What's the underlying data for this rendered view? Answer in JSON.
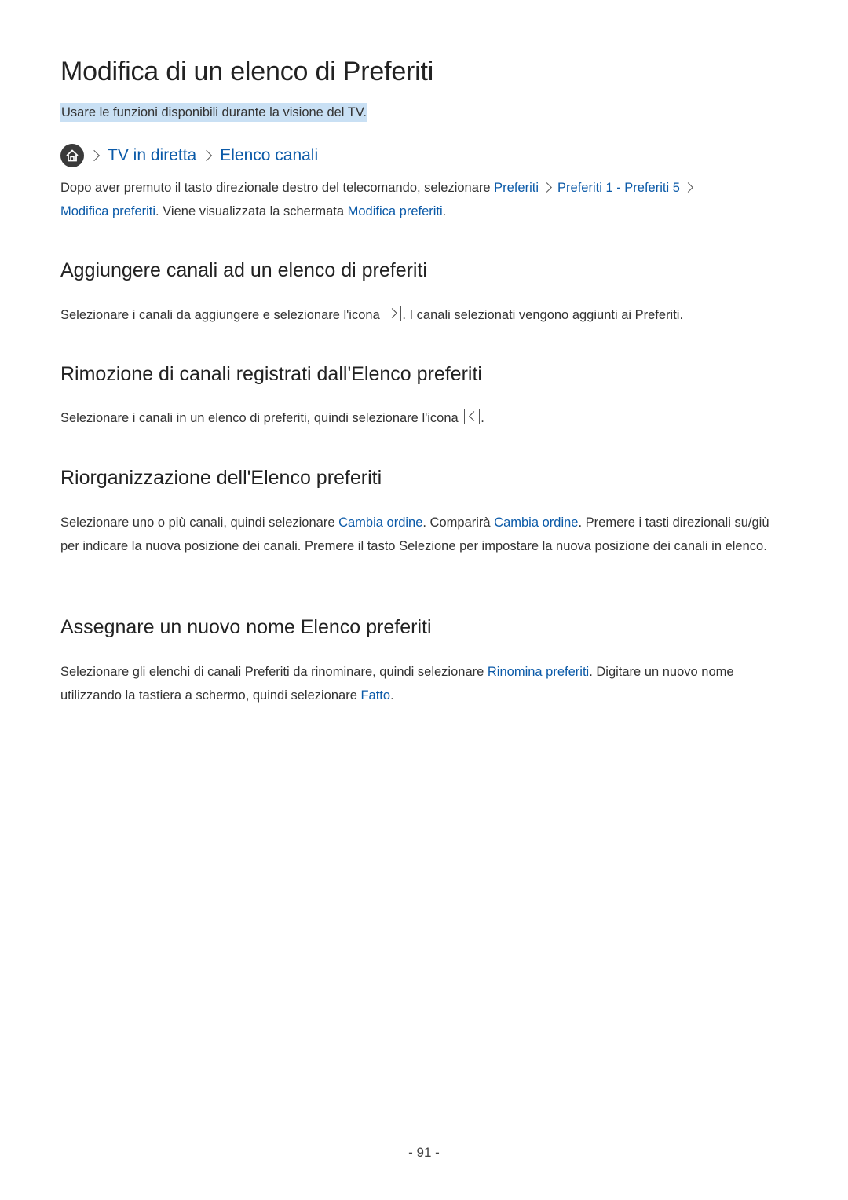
{
  "title": "Modifica di un elenco di Preferiti",
  "subtitle": "Usare le funzioni disponibili durante la visione del TV.",
  "breadcrumb": {
    "home_icon": "home-icon",
    "items": [
      "TV in diretta",
      "Elenco canali"
    ]
  },
  "intro": {
    "t1": "Dopo aver premuto il tasto direzionale destro del telecomando, selezionare ",
    "l1": "Preferiti",
    "l2": "Preferiti 1 - Preferiti 5",
    "l3": "Modifica preferiti",
    "t2": ". Viene visualizzata la schermata ",
    "l4": "Modifica preferiti",
    "t3": "."
  },
  "sections": [
    {
      "heading": "Aggiungere canali ad un elenco di preferiti",
      "t1": "Selezionare i canali da aggiungere e selezionare l'icona ",
      "icon": "chevron-right-box-icon",
      "t2": ". I canali selezionati vengono aggiunti ai Preferiti."
    },
    {
      "heading": "Rimozione di canali registrati dall'Elenco preferiti",
      "t1": "Selezionare i canali in un elenco di preferiti, quindi selezionare l'icona ",
      "icon": "chevron-left-box-icon",
      "t2": "."
    },
    {
      "heading": "Riorganizzazione dell'Elenco preferiti",
      "t1": "Selezionare uno o più canali, quindi selezionare ",
      "l1": "Cambia ordine",
      "t2": ". Comparirà ",
      "l2": "Cambia ordine",
      "t3": ". Premere i tasti direzionali su/giù per indicare la nuova posizione dei canali. Premere il tasto Selezione per impostare la nuova posizione dei canali in elenco."
    },
    {
      "heading": "Assegnare un nuovo nome Elenco preferiti",
      "t1": "Selezionare gli elenchi di canali Preferiti da rinominare, quindi selezionare ",
      "l1": "Rinomina preferiti",
      "t2": ". Digitare un nuovo nome utilizzando la tastiera a schermo, quindi selezionare ",
      "l2": "Fatto",
      "t3": "."
    }
  ],
  "page_number": "- 91 -",
  "colors": {
    "link": "#0b5aa8",
    "highlight": "#c9e0f4",
    "text": "#333333"
  }
}
